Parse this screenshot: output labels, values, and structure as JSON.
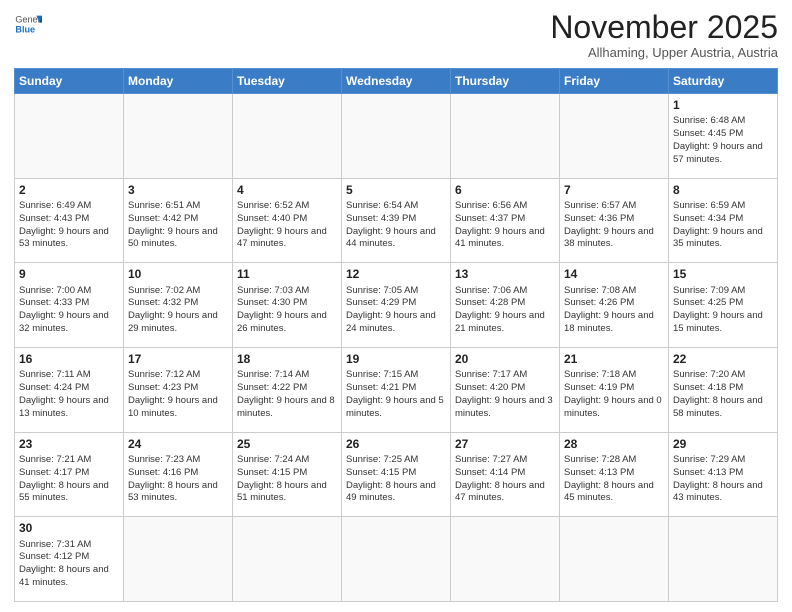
{
  "header": {
    "logo": {
      "general": "General",
      "blue": "Blue"
    },
    "title": "November 2025",
    "location": "Allhaming, Upper Austria, Austria"
  },
  "weekdays": [
    "Sunday",
    "Monday",
    "Tuesday",
    "Wednesday",
    "Thursday",
    "Friday",
    "Saturday"
  ],
  "weeks": [
    [
      {
        "day": "",
        "info": ""
      },
      {
        "day": "",
        "info": ""
      },
      {
        "day": "",
        "info": ""
      },
      {
        "day": "",
        "info": ""
      },
      {
        "day": "",
        "info": ""
      },
      {
        "day": "",
        "info": ""
      },
      {
        "day": "1",
        "info": "Sunrise: 6:48 AM\nSunset: 4:45 PM\nDaylight: 9 hours and 57 minutes."
      }
    ],
    [
      {
        "day": "2",
        "info": "Sunrise: 6:49 AM\nSunset: 4:43 PM\nDaylight: 9 hours and 53 minutes."
      },
      {
        "day": "3",
        "info": "Sunrise: 6:51 AM\nSunset: 4:42 PM\nDaylight: 9 hours and 50 minutes."
      },
      {
        "day": "4",
        "info": "Sunrise: 6:52 AM\nSunset: 4:40 PM\nDaylight: 9 hours and 47 minutes."
      },
      {
        "day": "5",
        "info": "Sunrise: 6:54 AM\nSunset: 4:39 PM\nDaylight: 9 hours and 44 minutes."
      },
      {
        "day": "6",
        "info": "Sunrise: 6:56 AM\nSunset: 4:37 PM\nDaylight: 9 hours and 41 minutes."
      },
      {
        "day": "7",
        "info": "Sunrise: 6:57 AM\nSunset: 4:36 PM\nDaylight: 9 hours and 38 minutes."
      },
      {
        "day": "8",
        "info": "Sunrise: 6:59 AM\nSunset: 4:34 PM\nDaylight: 9 hours and 35 minutes."
      }
    ],
    [
      {
        "day": "9",
        "info": "Sunrise: 7:00 AM\nSunset: 4:33 PM\nDaylight: 9 hours and 32 minutes."
      },
      {
        "day": "10",
        "info": "Sunrise: 7:02 AM\nSunset: 4:32 PM\nDaylight: 9 hours and 29 minutes."
      },
      {
        "day": "11",
        "info": "Sunrise: 7:03 AM\nSunset: 4:30 PM\nDaylight: 9 hours and 26 minutes."
      },
      {
        "day": "12",
        "info": "Sunrise: 7:05 AM\nSunset: 4:29 PM\nDaylight: 9 hours and 24 minutes."
      },
      {
        "day": "13",
        "info": "Sunrise: 7:06 AM\nSunset: 4:28 PM\nDaylight: 9 hours and 21 minutes."
      },
      {
        "day": "14",
        "info": "Sunrise: 7:08 AM\nSunset: 4:26 PM\nDaylight: 9 hours and 18 minutes."
      },
      {
        "day": "15",
        "info": "Sunrise: 7:09 AM\nSunset: 4:25 PM\nDaylight: 9 hours and 15 minutes."
      }
    ],
    [
      {
        "day": "16",
        "info": "Sunrise: 7:11 AM\nSunset: 4:24 PM\nDaylight: 9 hours and 13 minutes."
      },
      {
        "day": "17",
        "info": "Sunrise: 7:12 AM\nSunset: 4:23 PM\nDaylight: 9 hours and 10 minutes."
      },
      {
        "day": "18",
        "info": "Sunrise: 7:14 AM\nSunset: 4:22 PM\nDaylight: 9 hours and 8 minutes."
      },
      {
        "day": "19",
        "info": "Sunrise: 7:15 AM\nSunset: 4:21 PM\nDaylight: 9 hours and 5 minutes."
      },
      {
        "day": "20",
        "info": "Sunrise: 7:17 AM\nSunset: 4:20 PM\nDaylight: 9 hours and 3 minutes."
      },
      {
        "day": "21",
        "info": "Sunrise: 7:18 AM\nSunset: 4:19 PM\nDaylight: 9 hours and 0 minutes."
      },
      {
        "day": "22",
        "info": "Sunrise: 7:20 AM\nSunset: 4:18 PM\nDaylight: 8 hours and 58 minutes."
      }
    ],
    [
      {
        "day": "23",
        "info": "Sunrise: 7:21 AM\nSunset: 4:17 PM\nDaylight: 8 hours and 55 minutes."
      },
      {
        "day": "24",
        "info": "Sunrise: 7:23 AM\nSunset: 4:16 PM\nDaylight: 8 hours and 53 minutes."
      },
      {
        "day": "25",
        "info": "Sunrise: 7:24 AM\nSunset: 4:15 PM\nDaylight: 8 hours and 51 minutes."
      },
      {
        "day": "26",
        "info": "Sunrise: 7:25 AM\nSunset: 4:15 PM\nDaylight: 8 hours and 49 minutes."
      },
      {
        "day": "27",
        "info": "Sunrise: 7:27 AM\nSunset: 4:14 PM\nDaylight: 8 hours and 47 minutes."
      },
      {
        "day": "28",
        "info": "Sunrise: 7:28 AM\nSunset: 4:13 PM\nDaylight: 8 hours and 45 minutes."
      },
      {
        "day": "29",
        "info": "Sunrise: 7:29 AM\nSunset: 4:13 PM\nDaylight: 8 hours and 43 minutes."
      }
    ],
    [
      {
        "day": "30",
        "info": "Sunrise: 7:31 AM\nSunset: 4:12 PM\nDaylight: 8 hours and 41 minutes."
      },
      {
        "day": "",
        "info": ""
      },
      {
        "day": "",
        "info": ""
      },
      {
        "day": "",
        "info": ""
      },
      {
        "day": "",
        "info": ""
      },
      {
        "day": "",
        "info": ""
      },
      {
        "day": "",
        "info": ""
      }
    ]
  ]
}
